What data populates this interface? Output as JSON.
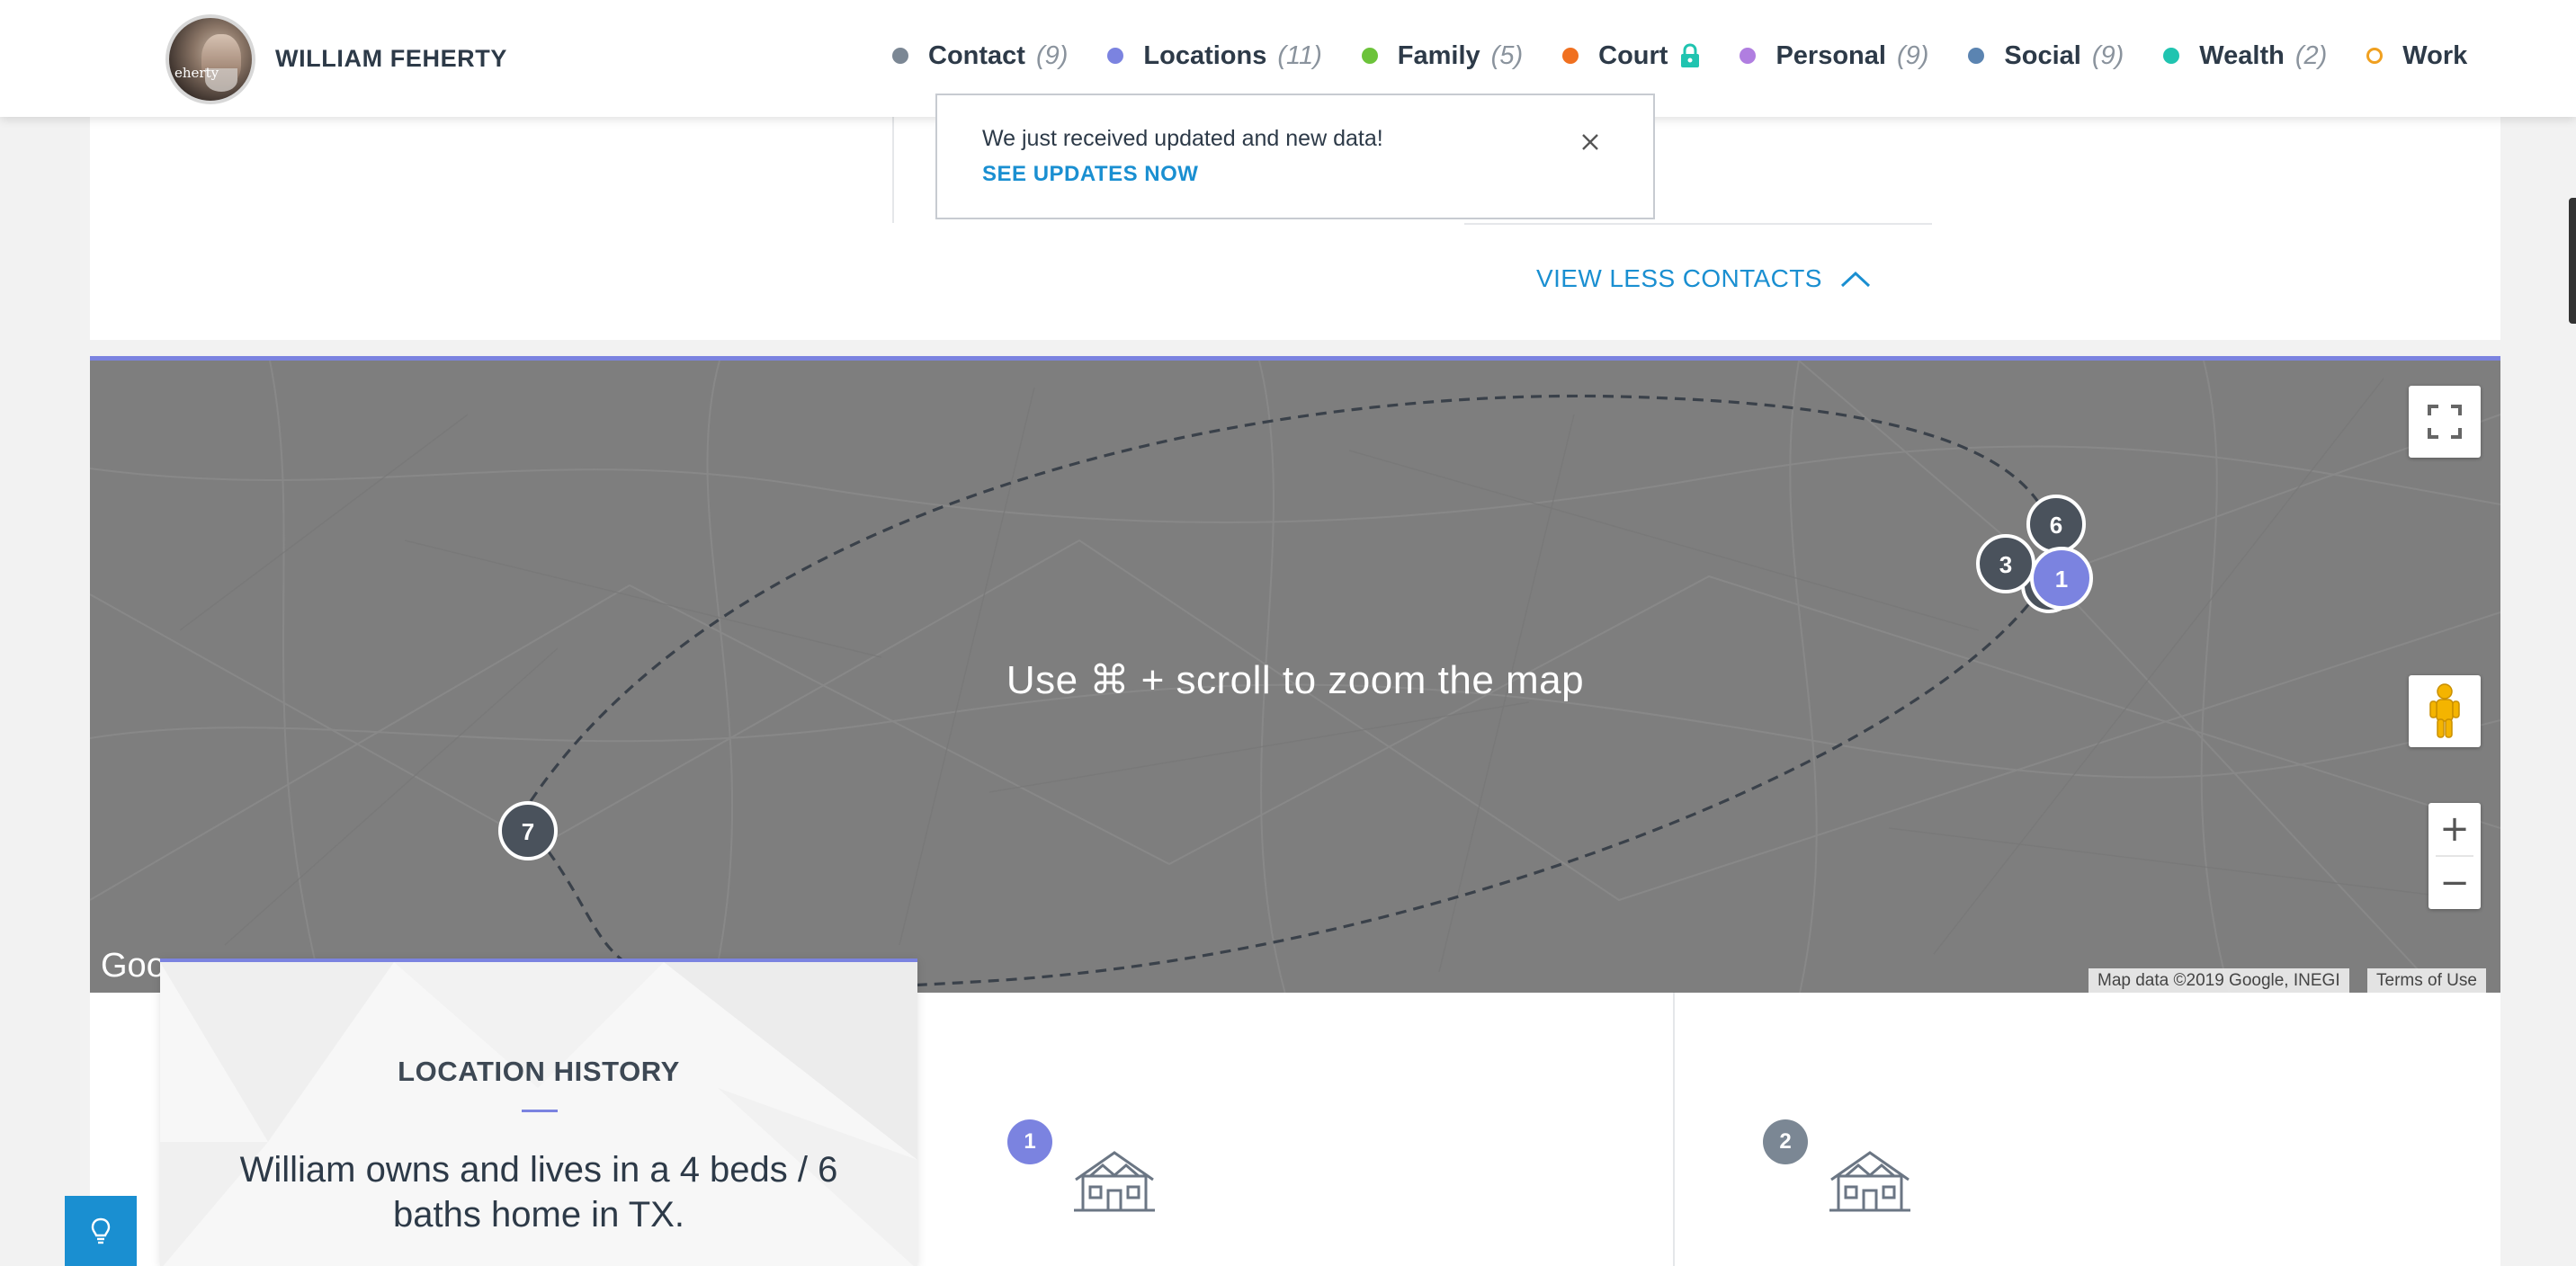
{
  "profile": {
    "name": "WILLIAM FEHERTY",
    "avatar_watermark": "eherty"
  },
  "nav": {
    "items": [
      {
        "label": "Contact",
        "count": "(9)",
        "color": "#7b8794"
      },
      {
        "label": "Locations",
        "count": "(11)",
        "color": "#7b83e0"
      },
      {
        "label": "Family",
        "count": "(5)",
        "color": "#6cc33a"
      },
      {
        "label": "Court",
        "count": "",
        "color": "#f07020",
        "icon": "lock-icon"
      },
      {
        "label": "Personal",
        "count": "(9)",
        "color": "#b07ee0"
      },
      {
        "label": "Social",
        "count": "(9)",
        "color": "#5b84b1"
      },
      {
        "label": "Wealth",
        "count": "(2)",
        "color": "#20c4b0"
      },
      {
        "label": "Work",
        "count": "",
        "color": "#f0a020"
      }
    ]
  },
  "notification": {
    "message": "We just received updated and new data!",
    "link": "SEE UPDATES NOW"
  },
  "contacts": {
    "toggle_label": "VIEW LESS CONTACTS"
  },
  "map": {
    "hint": "Use ⌘ + scroll to zoom the map",
    "google_mark": "Goo",
    "attribution": "Map data ©2019 Google, INEGI",
    "terms": "Terms of Use",
    "zoom_in": "+",
    "zoom_out": "−",
    "markers": [
      {
        "label": "6"
      },
      {
        "label": "3"
      },
      {
        "label": "1"
      },
      {
        "label": "7"
      }
    ]
  },
  "location_history": {
    "title": "LOCATION HISTORY",
    "summary": "William owns and lives in a 4 beds / 6 baths home in TX."
  },
  "locations": [
    {
      "number": "1",
      "color": "#7b83e0"
    },
    {
      "number": "2",
      "color": "#7b8794"
    }
  ]
}
